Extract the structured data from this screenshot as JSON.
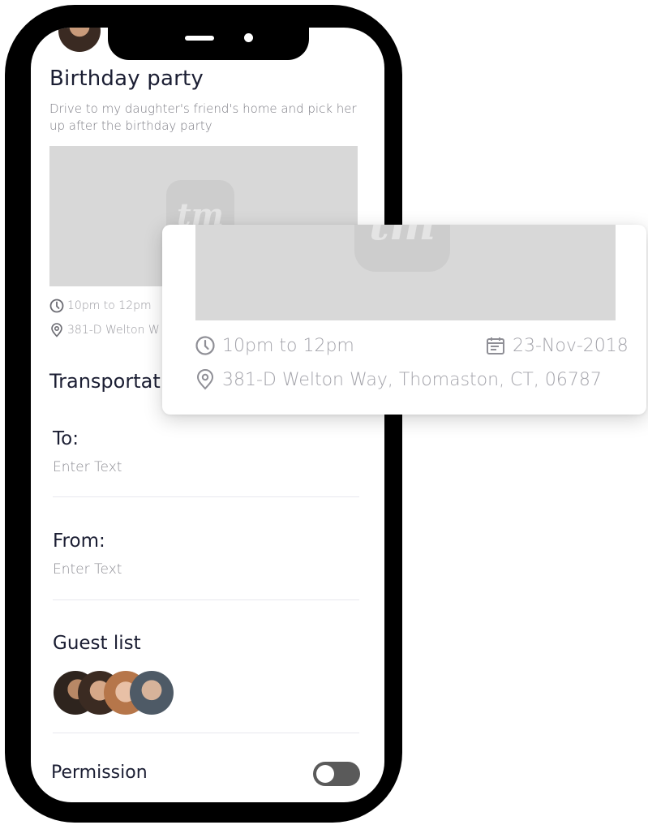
{
  "event": {
    "title": "Birthday party",
    "description": "Drive to my daughter's friend's home and pick her up after the birthday party",
    "time": "10pm to 12pm",
    "address_short": "381-D Welton W",
    "logo_text": "tm"
  },
  "transportation": {
    "heading": "Transportat",
    "to_label": "To:",
    "to_placeholder": "Enter Text",
    "from_label": "From:",
    "from_placeholder": "Enter Text"
  },
  "guests": {
    "heading": "Guest list",
    "avatars": [
      "guest-1",
      "guest-2",
      "guest-3",
      "guest-4"
    ]
  },
  "permission": {
    "label": "Permission",
    "enabled": false
  },
  "popup": {
    "time": "10pm to 12pm",
    "date": "23-Nov-2018",
    "address": "381-D Welton Way, Thomaston, CT, 06787",
    "logo_text": "tm"
  },
  "colors": {
    "heading": "#1b1e33",
    "muted": "#9a9aa0",
    "placeholder": "#d8d8d8",
    "toggle_off": "#5a5a5a"
  },
  "icons": {
    "time": "clock-icon",
    "location": "location-pin-icon",
    "date": "calendar-icon"
  }
}
